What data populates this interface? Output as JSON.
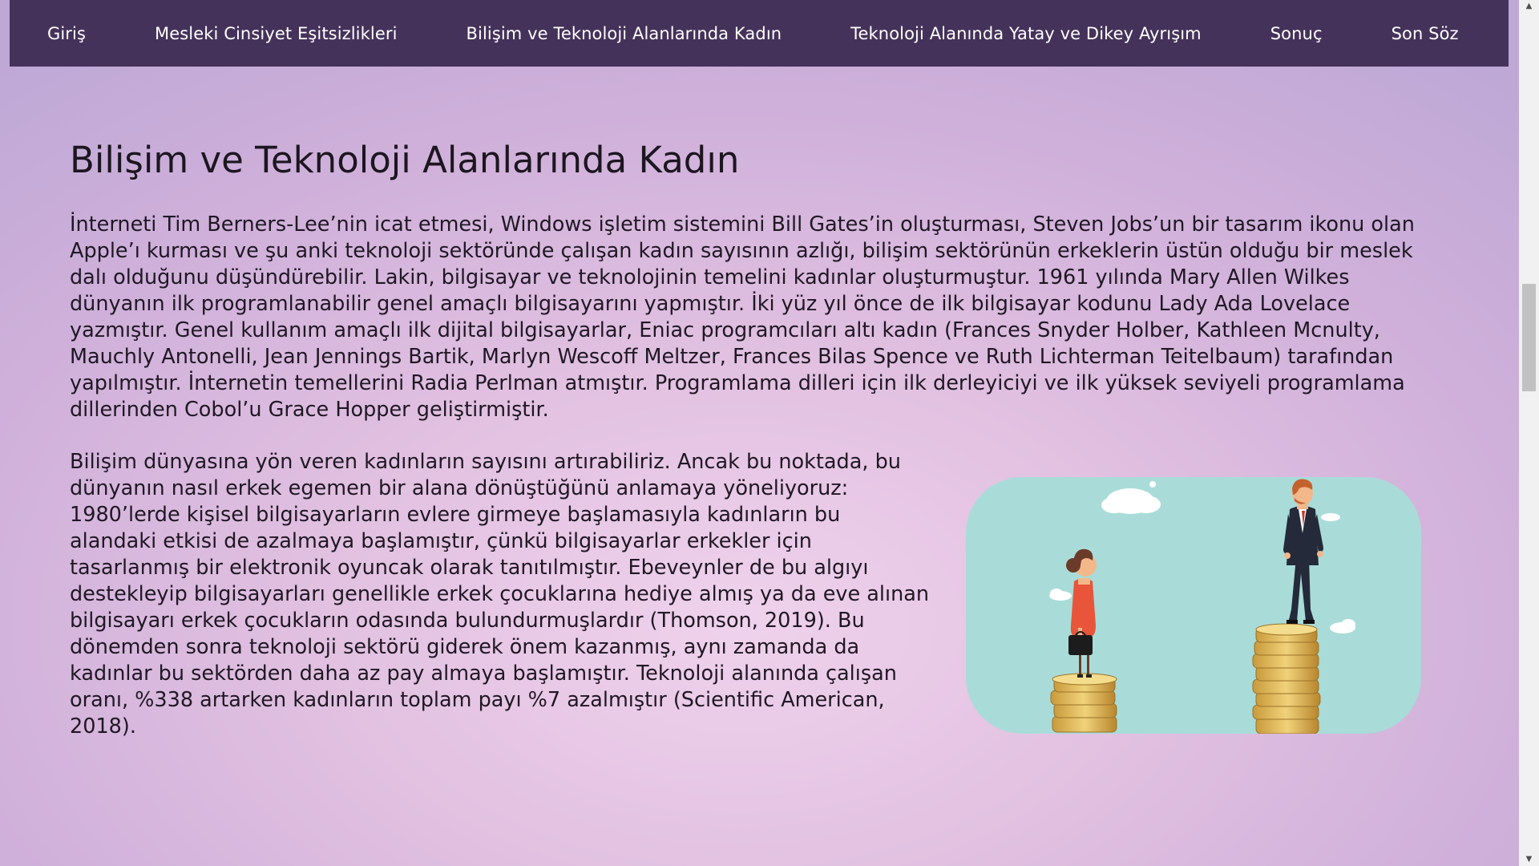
{
  "nav": {
    "items": [
      "Giriş",
      "Mesleki Cinsiyet Eşitsizlikleri",
      "Bilişim ve Teknoloji Alanlarında Kadın",
      "Teknoloji Alanında Yatay ve Dikey Ayrışım",
      "Sonuç",
      "Son Söz"
    ],
    "background": "#45325a"
  },
  "section": {
    "title": "Bilişim ve Teknoloji Alanlarında Kadın",
    "paragraph1": "İnterneti Tim Berners-Lee’nin icat etmesi, Windows işletim sistemini Bill Gates’in oluşturması, Steven Jobs’un bir tasarım ikonu olan Apple’ı kurması ve şu anki teknoloji sektöründe çalışan kadın sayısının azlığı, bilişim sektörünün erkeklerin üstün olduğu bir meslek dalı olduğunu düşündürebilir. Lakin, bilgisayar ve teknolojinin temelini kadınlar oluşturmuştur. 1961 yılında Mary Allen Wilkes dünyanın ilk programlanabilir genel amaçlı bilgisayarını yapmıştır. İki yüz yıl önce de ilk bilgisayar kodunu Lady Ada Lovelace yazmıştır. Genel kullanım amaçlı ilk dijital bilgisayarlar, Eniac programcıları altı kadın (Frances Snyder Holber, Kathleen Mcnulty, Mauchly Antonelli, Jean Jennings Bartik, Marlyn Wescoff Meltzer, Frances Bilas Spence ve Ruth Lichterman Teitelbaum) tarafından yapılmıştır.  İnternetin temellerini Radia Perlman atmıştır. Programlama dilleri için ilk derleyiciyi ve ilk yüksek seviyeli programlama dillerinden Cobol’u Grace Hopper geliştirmiştir.",
    "paragraph2": "Bilişim dünyasına yön veren kadınların sayısını artırabiliriz. Ancak bu noktada, bu dünyanın nasıl erkek egemen bir alana dönüştüğünü anlamaya yöneliyoruz: 1980’lerde kişisel bilgisayarların evlere girmeye başlamasıyla kadınların bu alandaki etkisi de azalmaya başlamıştır, çünkü bilgisayarlar erkekler için tasarlanmış bir elektronik oyuncak olarak tanıtılmıştır. Ebeveynler de bu algıyı destekleyip bilgisayarları genellikle erkek çocuklarına hediye almış ya da eve alınan bilgisayarı erkek çocukların odasında bulundurmuşlardır (Thomson, 2019). Bu dönemden sonra teknoloji sektörü giderek önem kazanmış, aynı zamanda da kadınlar bu sektörden daha az pay almaya başlamıştır. Teknoloji alanında çalışan oranı, %338 artarken kadınların toplam payı %7 azalmıştır (Scientific American, 2018).",
    "illustration_icon": "gender-inequality-coins-illustration"
  },
  "scrollbar": {
    "up_icon": "▲",
    "down_icon": "▼"
  }
}
